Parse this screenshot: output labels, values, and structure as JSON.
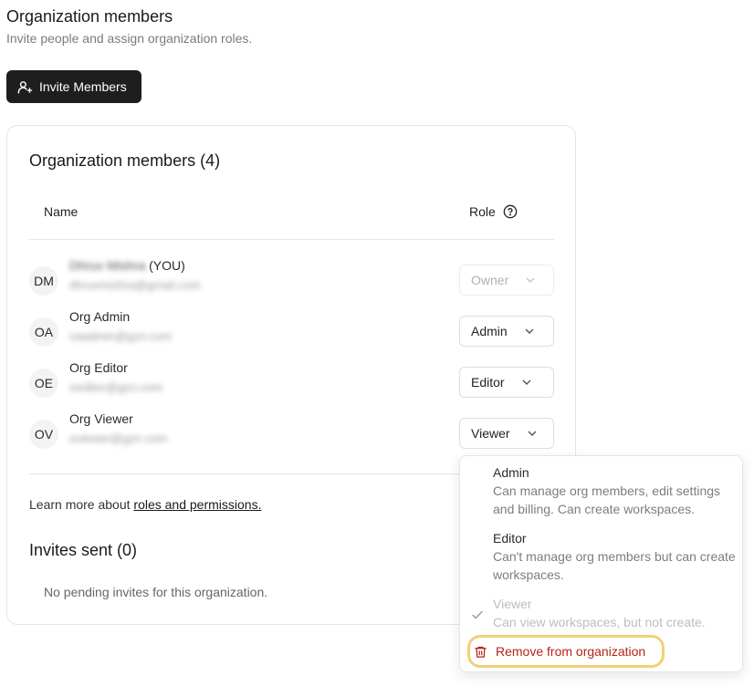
{
  "header": {
    "title": "Organization members",
    "subtitle": "Invite people and assign organization roles.",
    "invite_label": "Invite Members"
  },
  "members_card": {
    "title": "Organization members (4)",
    "col_name": "Name",
    "col_role": "Role",
    "members": [
      {
        "initials": "DM",
        "name": "Dhruv Mishra",
        "you_tag": "(YOU)",
        "email": "dhruvmishra@gmail.com",
        "role": "Owner"
      },
      {
        "initials": "OA",
        "name": "Org Admin",
        "email": "oaadmin@gzn.com",
        "role": "Admin"
      },
      {
        "initials": "OE",
        "name": "Org Editor",
        "email": "oeditor@gzn.com",
        "role": "Editor"
      },
      {
        "initials": "OV",
        "name": "Org Viewer",
        "email": "oviewer@gzn.com",
        "role": "Viewer"
      }
    ],
    "learn_prefix": "Learn more about ",
    "learn_link": "roles and permissions.",
    "invites_title": "Invites sent (0)",
    "no_invites": "No pending invites for this organization."
  },
  "role_dropdown": {
    "options": [
      {
        "title": "Admin",
        "desc": "Can manage org members, edit settings and billing. Can create workspaces."
      },
      {
        "title": "Editor",
        "desc": "Can't manage org members but can create workspaces."
      },
      {
        "title": "Viewer",
        "desc": "Can view workspaces, but not create.",
        "selected": true
      }
    ],
    "remove_label": "Remove from organization"
  },
  "colors": {
    "button_dark": "#1e1e1e",
    "danger": "#b42318",
    "highlight": "#f2cf7a"
  }
}
